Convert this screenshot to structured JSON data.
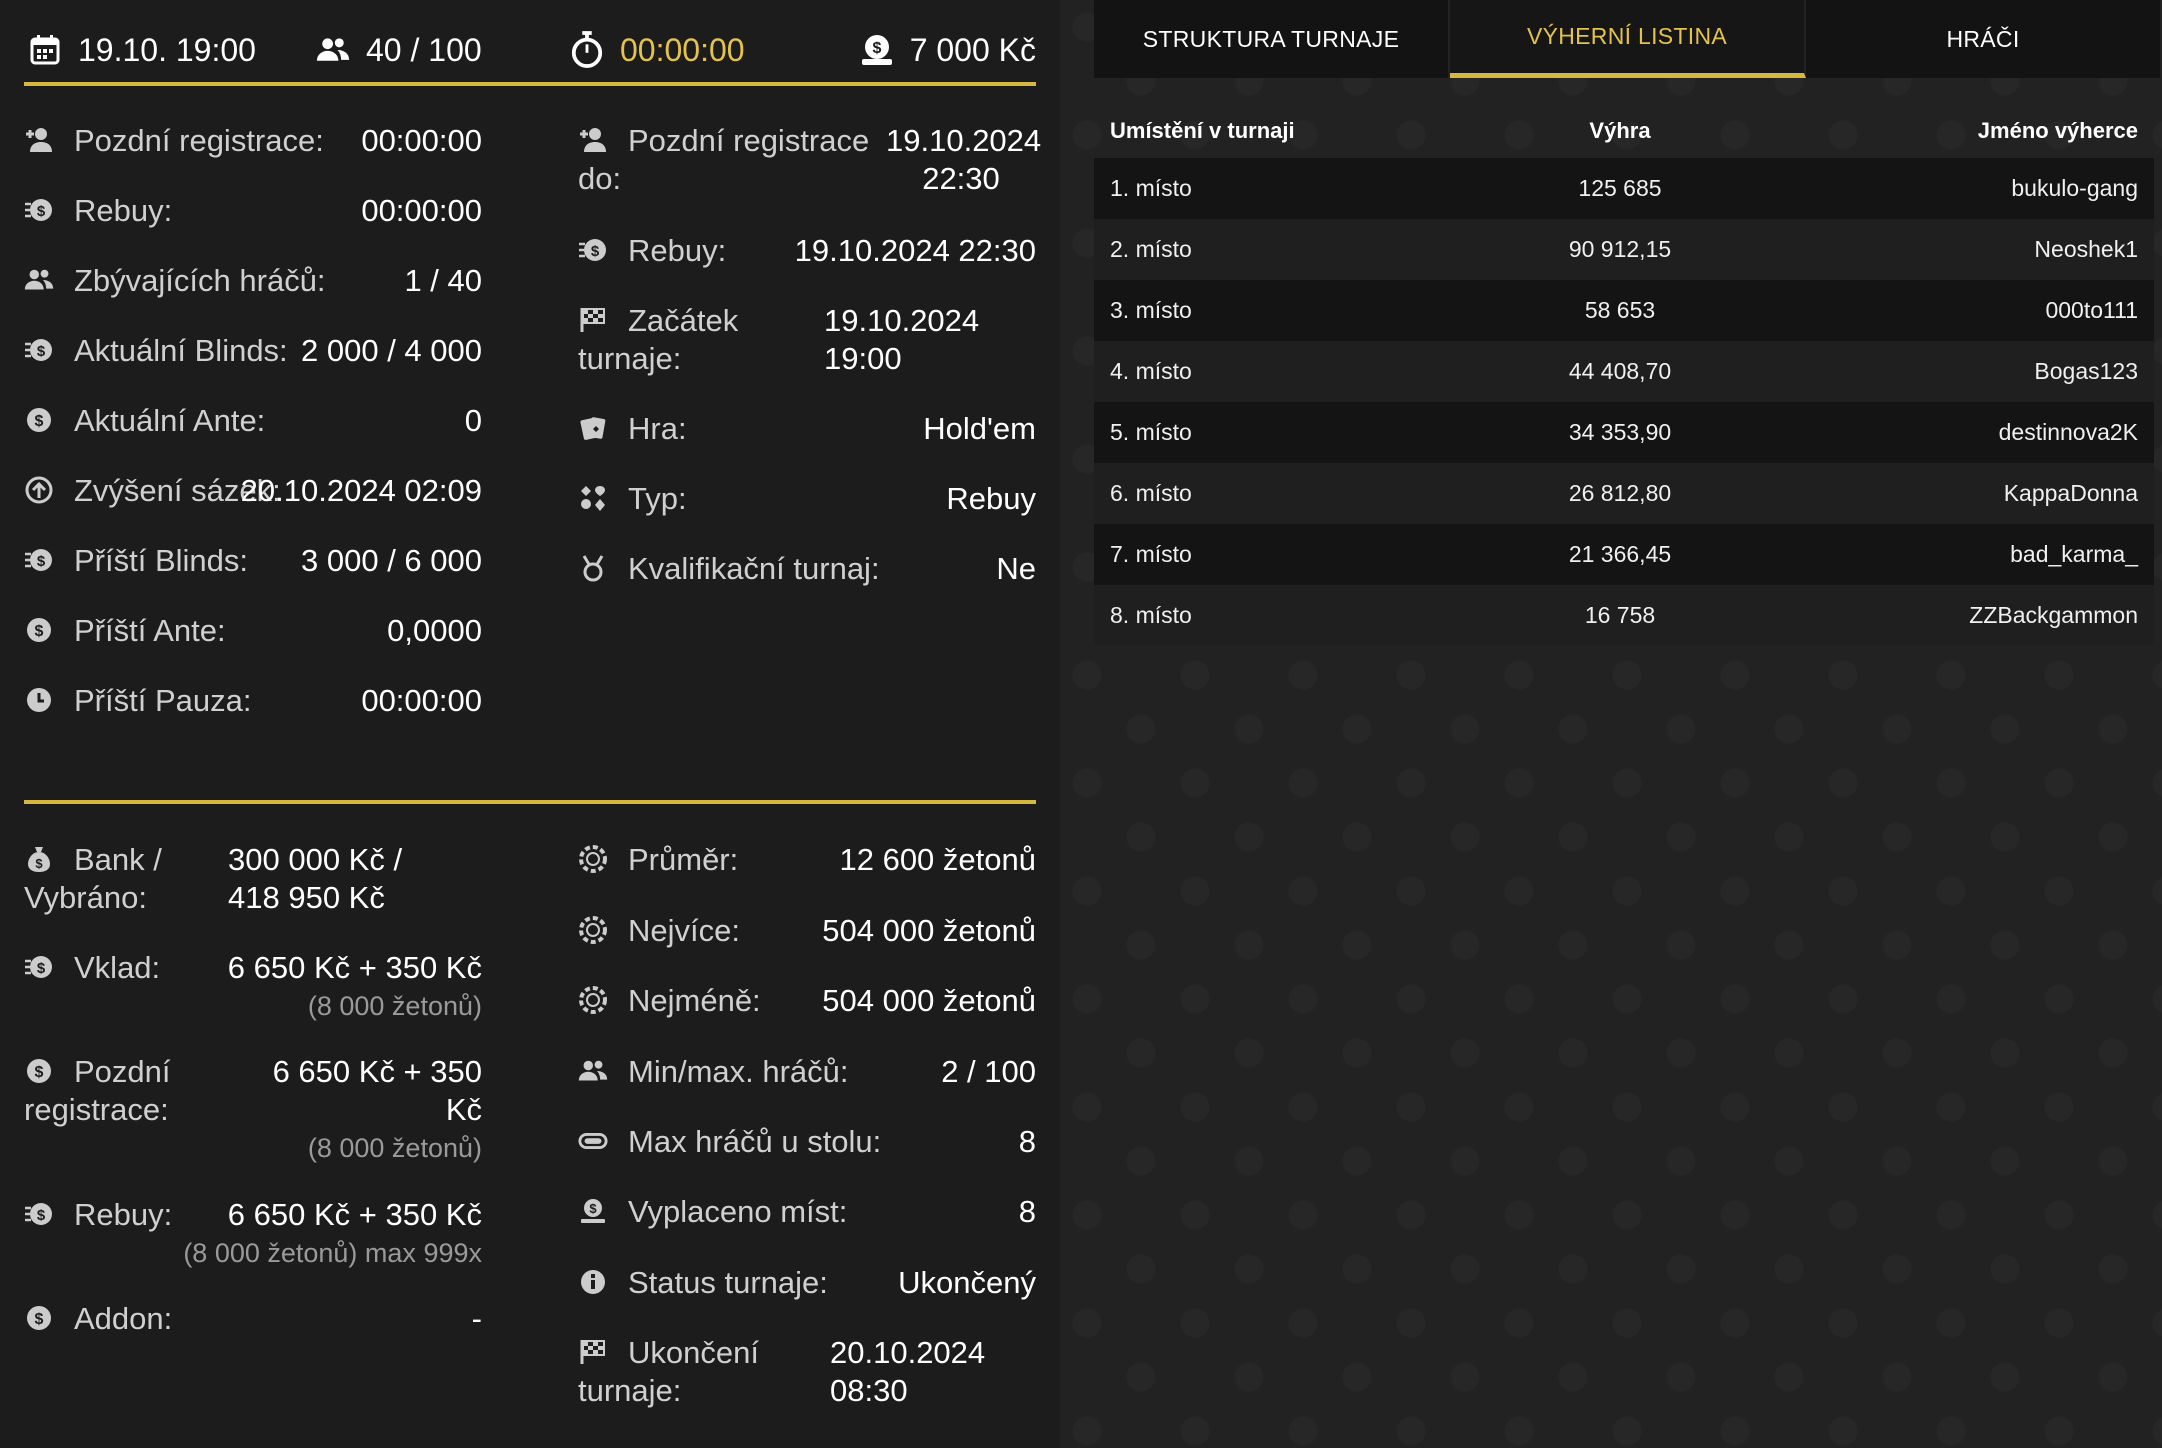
{
  "topbar": {
    "date": "19.10. 19:00",
    "players": "40 / 100",
    "timer": "00:00:00",
    "prize": "7 000 Kč"
  },
  "left_info": [
    {
      "label": "Pozdní registrace:",
      "value": "00:00:00",
      "icon": "user-plus-icon"
    },
    {
      "label": "Rebuy:",
      "value": "00:00:00",
      "icon": "rebuy-coins-icon"
    },
    {
      "label": "Zbývajících hráčů:",
      "value": "1 / 40",
      "icon": "users-icon"
    },
    {
      "label": "Aktuální Blinds:",
      "value": "2 000 / 4 000",
      "icon": "blinds-coins-icon"
    },
    {
      "label": "Aktuální Ante:",
      "value": "0",
      "icon": "dollar-coin-icon"
    },
    {
      "label": "Zvýšení sázek:",
      "value": "20.10.2024 02:09",
      "icon": "arrow-up-circle-icon"
    },
    {
      "label": "Příští Blinds:",
      "value": "3 000 / 6 000",
      "icon": "blinds-coins-icon"
    },
    {
      "label": "Příští Ante:",
      "value": "0,0000",
      "icon": "dollar-coin-icon"
    },
    {
      "label": "Příští Pauza:",
      "value": "00:00:00",
      "icon": "clock-icon"
    }
  ],
  "right_info": {
    "late_reg_label": "Pozdní registrace do:",
    "late_reg_label_l1": "Pozdní registrace",
    "late_reg_label_l2": "do:",
    "late_reg_value_l1": "19.10.2024",
    "late_reg_value_l2": "22:30",
    "rebuy_label": "Rebuy:",
    "rebuy_value": "19.10.2024 22:30",
    "start_label_l1": "Začátek",
    "start_label_l2": "turnaje:",
    "start_value_l1": "19.10.2024",
    "start_value_l2": "19:00",
    "game_label": "Hra:",
    "game_value": "Hold'em",
    "type_label": "Typ:",
    "type_value": "Rebuy",
    "qual_label": "Kvalifikační turnaj:",
    "qual_value": "Ne"
  },
  "bottom_left": {
    "bank_label_l1": "Bank /",
    "bank_label_l2": "Vybráno:",
    "bank_value_l1": "300 000 Kč /",
    "bank_value_l2": "418 950 Kč",
    "deposit_label": "Vklad:",
    "deposit_value": "6 650 Kč + 350 Kč",
    "deposit_sub": "(8 000 žetonů)",
    "late_label_l1": "Pozdní",
    "late_label_l2": "registrace:",
    "late_value_l1": "6 650 Kč + 350",
    "late_value_l2": "Kč",
    "late_sub": "(8 000 žetonů)",
    "rebuy_label": "Rebuy:",
    "rebuy_value": "6 650 Kč + 350 Kč",
    "rebuy_sub": "(8 000 žetonů) max 999x",
    "addon_label": "Addon:",
    "addon_value": "-"
  },
  "bottom_right": [
    {
      "label": "Průměr:",
      "value": "12 600 žetonů",
      "icon": "chip-icon"
    },
    {
      "label": "Nejvíce:",
      "value": "504 000 žetonů",
      "icon": "chip-icon"
    },
    {
      "label": "Nejméně:",
      "value": "504 000 žetonů",
      "icon": "chip-icon"
    },
    {
      "label": "Min/max. hráčů:",
      "value": "2 / 100",
      "icon": "users-icon"
    },
    {
      "label": "Max hráčů u stolu:",
      "value": "8",
      "icon": "poker-table-icon"
    },
    {
      "label": "Vyplaceno míst:",
      "value": "8",
      "icon": "payout-icon"
    },
    {
      "label": "Status turnaje:",
      "value": "Ukončený",
      "icon": "info-icon"
    }
  ],
  "end": {
    "label_l1": "Ukončení",
    "label_l2": "turnaje:",
    "value_l1": "20.10.2024",
    "value_l2": "08:30"
  },
  "tabs": [
    {
      "label": "STRUKTURA TURNAJE",
      "active": false
    },
    {
      "label": "VÝHERNÍ LISTINA",
      "active": true
    },
    {
      "label": "HRÁČI",
      "active": false
    }
  ],
  "table": {
    "headers": [
      "Umístění v turnaji",
      "Výhra",
      "Jméno výherce"
    ],
    "rows": [
      [
        "1. místo",
        "125 685",
        "bukulo-gang"
      ],
      [
        "2. místo",
        "90 912,15",
        "Neoshek1"
      ],
      [
        "3. místo",
        "58 653",
        "000to111"
      ],
      [
        "4. místo",
        "44 408,70",
        "Bogas123"
      ],
      [
        "5. místo",
        "34 353,90",
        "destinnova2K"
      ],
      [
        "6. místo",
        "26 812,80",
        "KappaDonna"
      ],
      [
        "7. místo",
        "21 366,45",
        "bad_karma_"
      ],
      [
        "8. místo",
        "16 758",
        "ZZBackgammon"
      ]
    ]
  },
  "colors": {
    "accent": "#d6b73f",
    "accent_text": "#e4c34c"
  }
}
